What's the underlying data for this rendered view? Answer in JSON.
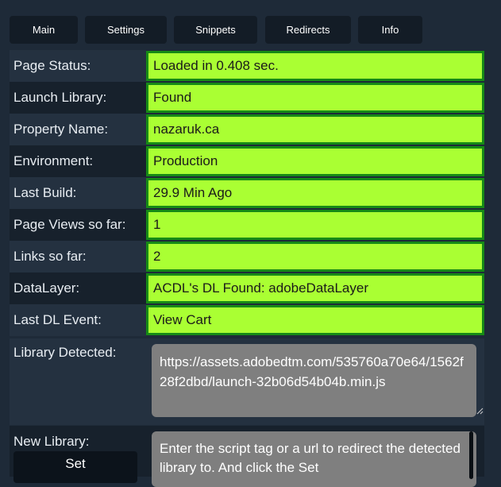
{
  "tabs": [
    {
      "label": "Main"
    },
    {
      "label": "Settings"
    },
    {
      "label": "Snippets"
    },
    {
      "label": "Redirects"
    },
    {
      "label": "Info"
    }
  ],
  "rows": [
    {
      "label": "Page Status:",
      "value": "Loaded in 0.408 sec."
    },
    {
      "label": "Launch Library:",
      "value": "Found"
    },
    {
      "label": "Property Name:",
      "value": "nazaruk.ca"
    },
    {
      "label": "Environment:",
      "value": "Production"
    },
    {
      "label": "Last Build:",
      "value": "29.9 Min Ago"
    },
    {
      "label": "Page Views so far:",
      "value": "1"
    },
    {
      "label": "Links so far:",
      "value": "2"
    },
    {
      "label": "DataLayer:",
      "value": "ACDL's DL Found: adobeDataLayer"
    },
    {
      "label": "Last DL Event:",
      "value": "View Cart"
    }
  ],
  "library_detected": {
    "label": "Library Detected:",
    "value": "https://assets.adobedtm.com/535760a70e64/1562f28f2dbd/launch-32b06d54b04b.min.js"
  },
  "new_library": {
    "label": "New Library:",
    "button_label": "Set",
    "placeholder": "Enter the script tag or a url to redirect the detected library to. And click the Set"
  },
  "colors": {
    "background": "#1e2a38",
    "value_fill": "#aaff33",
    "value_border": "#168a16",
    "tab_bg": "#131c26"
  }
}
